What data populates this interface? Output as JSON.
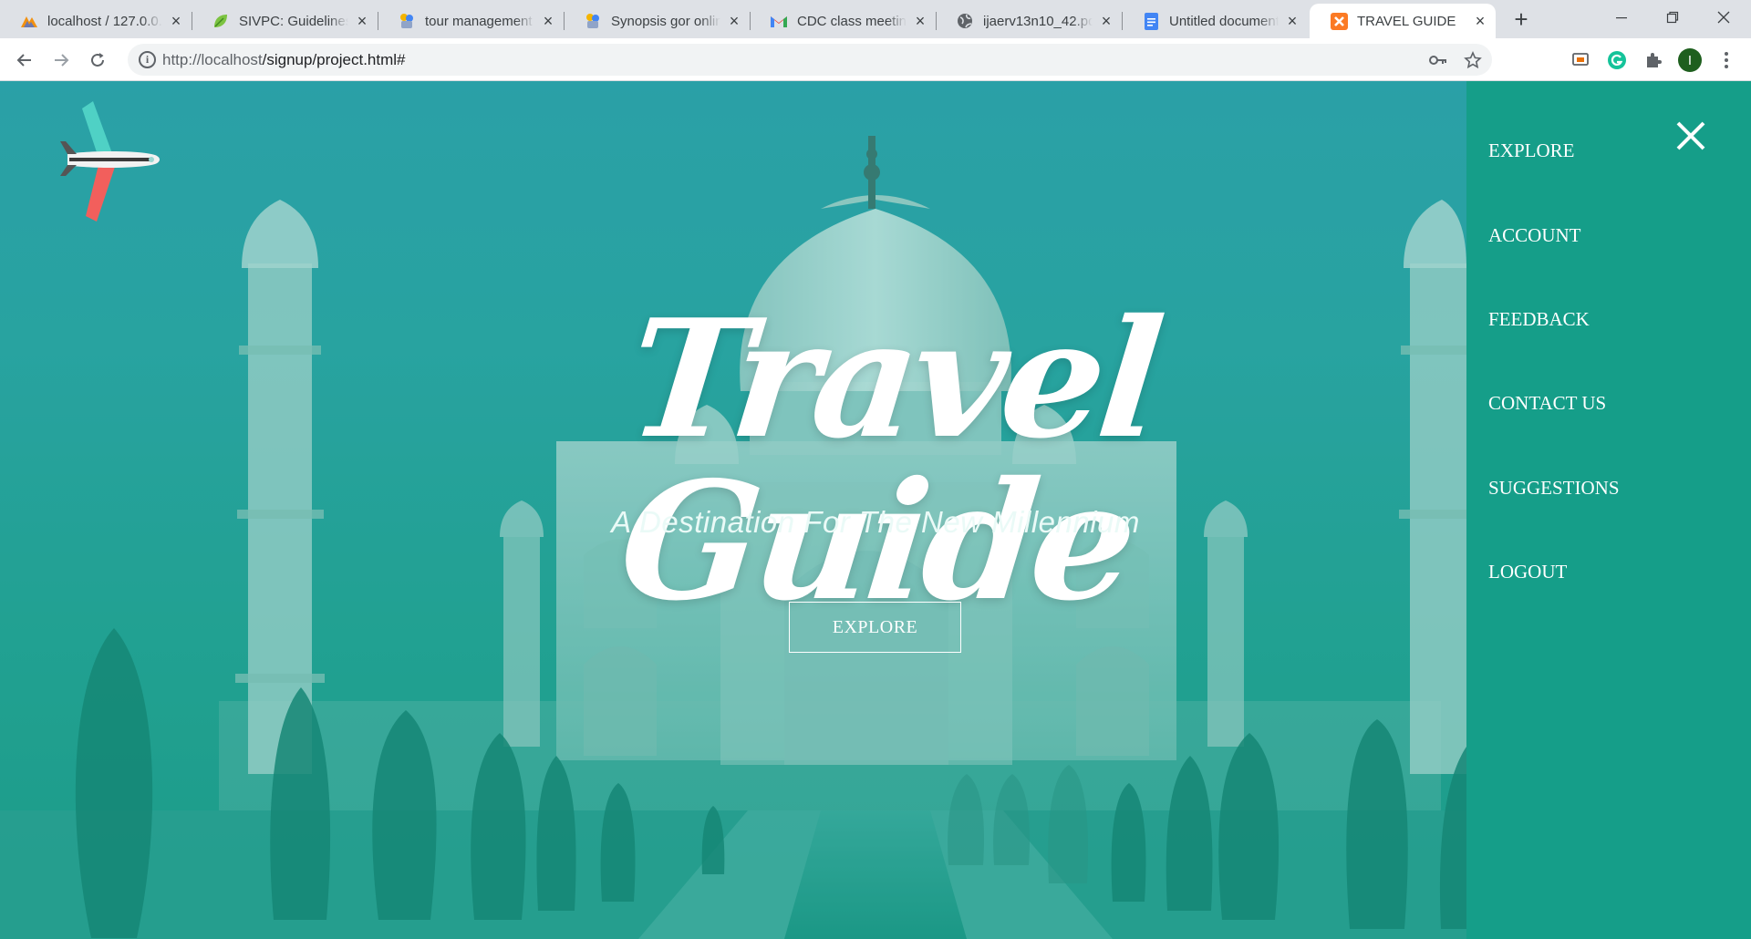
{
  "browser": {
    "tabs": [
      {
        "title": "localhost / 127.0.0.1",
        "icon": "phpmyadmin-icon"
      },
      {
        "title": "SIVPC: Guidelines for",
        "icon": "leaf-icon"
      },
      {
        "title": "tour management",
        "icon": "tour-app-icon"
      },
      {
        "title": "Synopsis gor online",
        "icon": "tour-app-icon"
      },
      {
        "title": "CDC class meeting",
        "icon": "gmail-icon"
      },
      {
        "title": "ijaerv13n10_42.pdf",
        "icon": "globe-icon"
      },
      {
        "title": "Untitled document",
        "icon": "docs-icon"
      },
      {
        "title": "TRAVEL GUIDE",
        "icon": "xampp-icon",
        "active": true
      }
    ],
    "url_host": "http://localhost",
    "url_path": "/signup/project.html#",
    "profile_initial": "I",
    "colors": {
      "tabstrip": "#dee1e6",
      "toolbar": "#ffffff",
      "profile": "#1e5f1e"
    }
  },
  "page": {
    "hero": {
      "title": "Travel Guide",
      "subtitle": "A Destination For The New Millennium",
      "button_label": "EXPLORE",
      "background": "taj-mahal-photo",
      "overlay_color": "#1fa393"
    },
    "sidenav": {
      "color": "#159e89",
      "items": [
        "EXPLORE",
        "ACCOUNT",
        "FEEDBACK",
        "CONTACT US",
        "SUGGESTIONS",
        "LOGOUT"
      ]
    }
  }
}
